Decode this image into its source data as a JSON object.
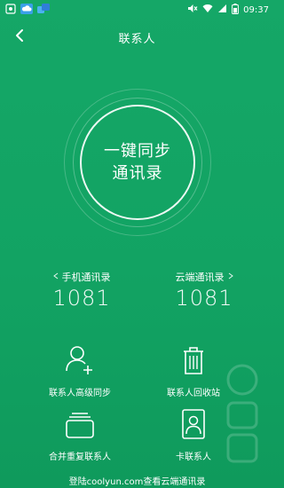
{
  "status_bar": {
    "time": "09:37",
    "left_icons": [
      "screenshot-icon",
      "cloud-icon",
      "sync-app-icon"
    ],
    "right_icons": [
      "mute-icon",
      "wifi-icon",
      "signal-icon",
      "battery-icon"
    ]
  },
  "header": {
    "title": "联系人",
    "back_icon": "chevron-left-icon"
  },
  "sync": {
    "line1": "一键同步",
    "line2": "通讯录"
  },
  "counts": {
    "phone": {
      "label": "手机通讯录",
      "value": "1081"
    },
    "cloud": {
      "label": "云端通讯录",
      "value": "1081"
    }
  },
  "actions": [
    {
      "label": "联系人高级同步",
      "icon": "add-user-icon"
    },
    {
      "label": "联系人回收站",
      "icon": "trash-icon"
    },
    {
      "label": "合并重复联系人",
      "icon": "merge-cards-icon"
    },
    {
      "label": "卡联系人",
      "icon": "contact-card-icon"
    }
  ],
  "footer": {
    "text": "登陆coolyun.com查看云端通讯录"
  },
  "colors": {
    "background": "#13a465",
    "foreground": "#ffffff"
  }
}
